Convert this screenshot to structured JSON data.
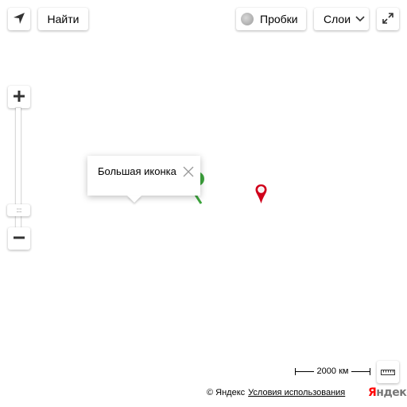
{
  "toolbar": {
    "search_label": "Найти",
    "traffic_label": "Пробки",
    "layers_label": "Слои"
  },
  "balloon": {
    "text": "Большая иконка"
  },
  "markers": [
    {
      "name": "green-marker",
      "color": "#3da53d"
    },
    {
      "name": "red-marker",
      "color": "#d0021b"
    }
  ],
  "scale": {
    "text": "2000 км"
  },
  "copyrights": {
    "owner": "© Яндекс",
    "terms_link": "Условия использования"
  },
  "logo": {
    "first_letter": "Я",
    "rest": "ндекс"
  },
  "icons": [
    "geolocation-icon",
    "traffic-icon",
    "chevron-down-icon",
    "fullscreen-icon",
    "plus-icon",
    "minus-icon",
    "close-icon",
    "ruler-icon"
  ]
}
